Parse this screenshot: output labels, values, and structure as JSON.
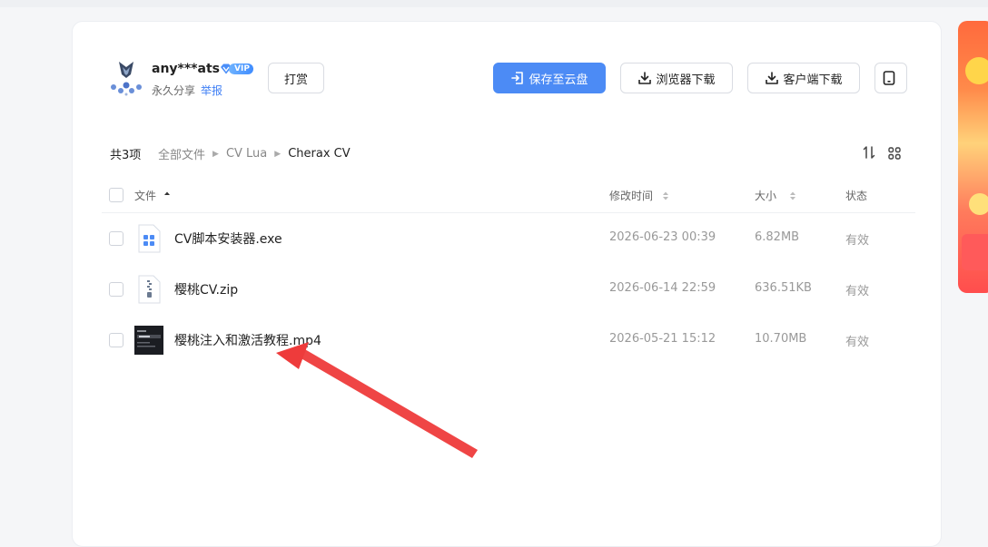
{
  "header": {
    "user_name": "any***ats",
    "vip_label": "VIP",
    "share_type": "永久分享",
    "report_label": "举报",
    "tip_label": "打赏",
    "save_label": "保存至云盘",
    "browser_download_label": "浏览器下载",
    "client_download_label": "客户端下载"
  },
  "breadcrumb": {
    "count": "共3项",
    "items": [
      "全部文件",
      "CV Lua",
      "Cherax CV"
    ]
  },
  "table": {
    "columns": [
      "文件",
      "修改时间",
      "大小",
      "状态"
    ],
    "rows": [
      {
        "name": "CV脚本安装器.exe",
        "date": "2026-06-23 00:39",
        "size": "6.82MB",
        "status": "有效",
        "icon": "exe-file-icon"
      },
      {
        "name": "樱桃CV.zip",
        "date": "2026-06-14 22:59",
        "size": "636.51KB",
        "status": "有效",
        "icon": "zip-file-icon"
      },
      {
        "name": "樱桃注入和激活教程.mp4",
        "date": "2026-05-21 15:12",
        "size": "10.70MB",
        "status": "有效",
        "icon": "video-thumbnail"
      }
    ]
  },
  "colors": {
    "primary": "#4c8bf5",
    "annotation_arrow": "#ee3b3b"
  }
}
